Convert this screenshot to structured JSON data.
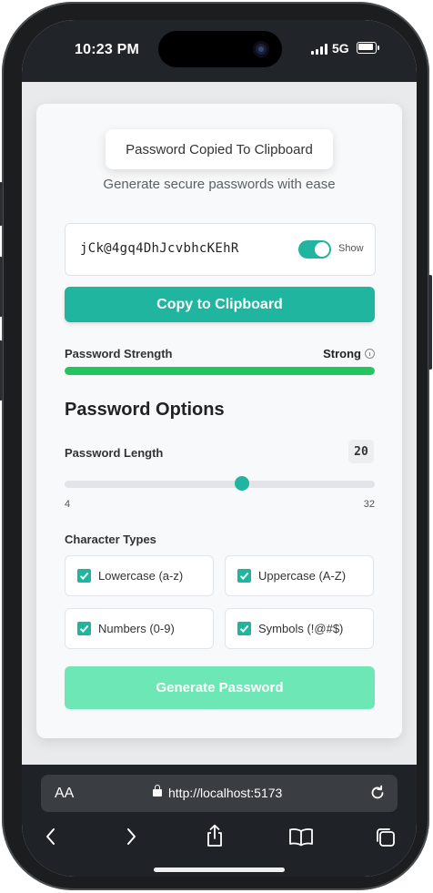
{
  "status_bar": {
    "time": "10:23 PM",
    "network": "5G"
  },
  "toast": {
    "text": "Password Copied To Clipboard"
  },
  "app": {
    "subtitle": "Generate secure passwords with ease"
  },
  "password": {
    "value": "jCk@4gq4DhJcvbhcKEhR",
    "show_label": "Show",
    "show_enabled": true
  },
  "copy_button": {
    "label": "Copy to Clipboard"
  },
  "strength": {
    "label": "Password Strength",
    "value": "Strong",
    "level_percent": 100,
    "color": "#22c55e"
  },
  "options": {
    "title": "Password Options",
    "length": {
      "label": "Password Length",
      "value": "20",
      "min": "4",
      "max": "32"
    },
    "character_types": {
      "title": "Character Types",
      "items": [
        {
          "label": "Lowercase (a-z)",
          "checked": true
        },
        {
          "label": "Uppercase (A-Z)",
          "checked": true
        },
        {
          "label": "Numbers (0-9)",
          "checked": true
        },
        {
          "label": "Symbols (!@#$)",
          "checked": true
        }
      ]
    }
  },
  "generate_button": {
    "label": "Generate Password"
  },
  "browser": {
    "text_size_label": "AA",
    "url": "http://localhost:5173"
  },
  "colors": {
    "accent": "#20b59e",
    "generate": "#6ee7b7",
    "strength": "#22c55e"
  }
}
